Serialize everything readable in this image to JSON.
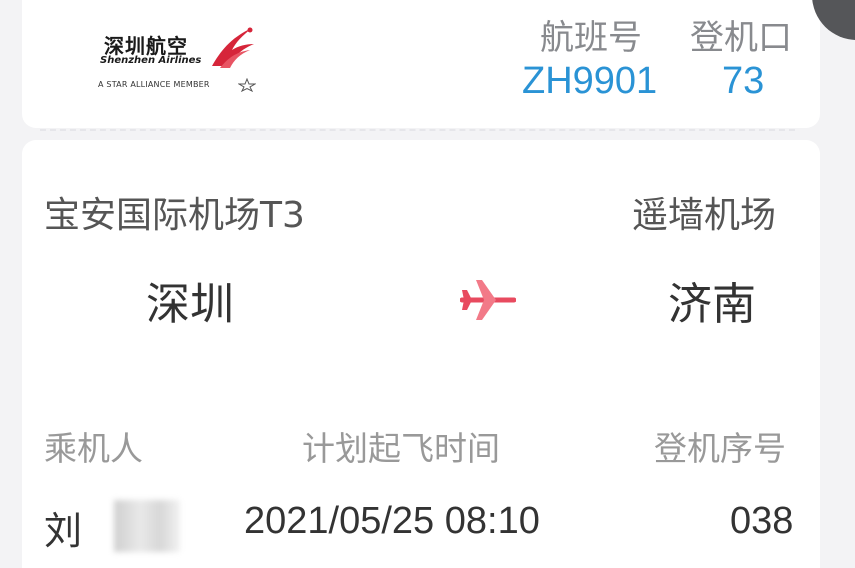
{
  "logo": {
    "name_cn": "深圳航空",
    "name_en": "Shenzhen Airlines",
    "alliance": "A STAR ALLIANCE MEMBER"
  },
  "flight": {
    "flight_no_label": "航班号",
    "flight_no": "ZH9901",
    "gate_label": "登机口",
    "gate": "73"
  },
  "route": {
    "origin_airport": "宝安国际机场T3",
    "origin_city": "深圳",
    "dest_airport": "遥墙机场",
    "dest_city": "济南"
  },
  "details": {
    "passenger_label": "乘机人",
    "passenger_name": "刘",
    "departure_time_label": "计划起飞时间",
    "departure_time": "2021/05/25 08:10",
    "boarding_seq_label": "登机序号",
    "boarding_seq": "038"
  },
  "colors": {
    "accent_blue": "#2a93d5",
    "plane_red": "#e84a5f"
  }
}
